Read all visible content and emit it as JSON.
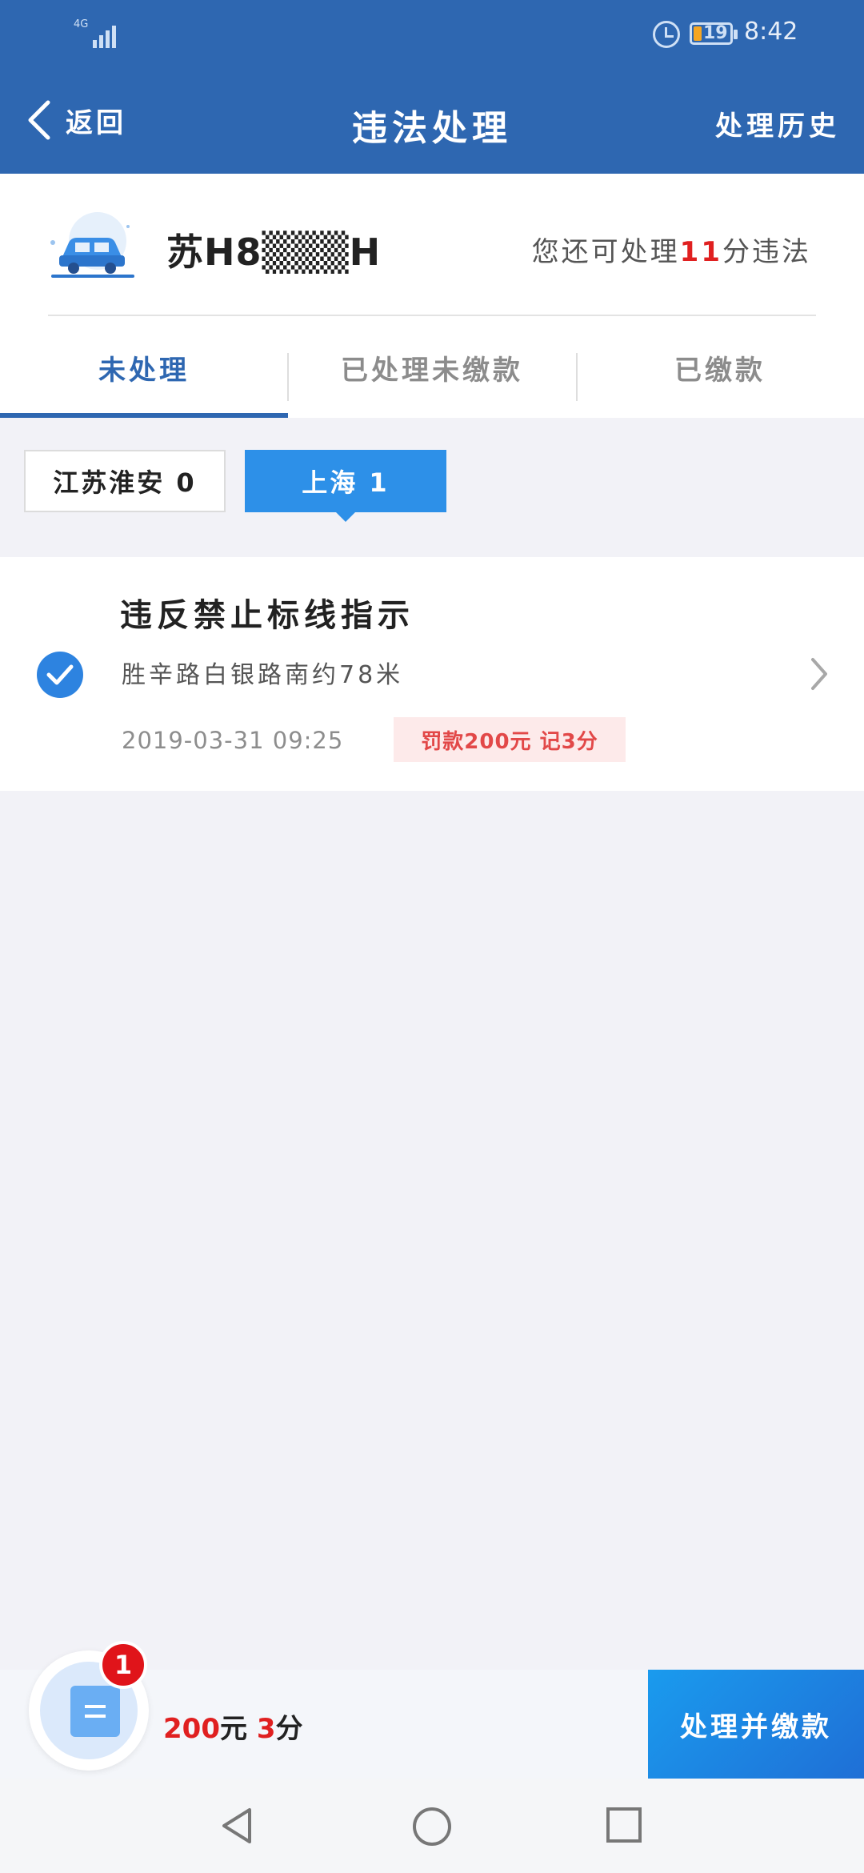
{
  "status_bar": {
    "network": "4G",
    "battery": "19",
    "time": "8:42"
  },
  "header": {
    "back_label": "返回",
    "title": "违法处理",
    "history_label": "处理历史"
  },
  "vehicle": {
    "plate": "苏H8▒▒▒H",
    "remaining_prefix": "您还可处理",
    "remaining_points": "11",
    "remaining_suffix": "分违法"
  },
  "tabs": [
    {
      "label": "未处理",
      "active": true
    },
    {
      "label": "已处理未缴款",
      "active": false
    },
    {
      "label": "已缴款",
      "active": false
    }
  ],
  "regions": [
    {
      "label": "江苏淮安 0",
      "selected": false
    },
    {
      "label": "上海 1",
      "selected": true
    }
  ],
  "violations": [
    {
      "title": "违反禁止标线指示",
      "location": "胜辛路白银路南约78米",
      "time": "2019-03-31 09:25",
      "penalty": "罚款200元 记3分",
      "checked": true
    }
  ],
  "summary": {
    "count": "1",
    "amount": "200",
    "amount_unit": "元 ",
    "points": "3",
    "points_unit": "分",
    "pay_label": "处理并缴款"
  },
  "colors": {
    "brand": "#2e67b1",
    "accent": "#2d90e8",
    "alert": "#e02020"
  }
}
